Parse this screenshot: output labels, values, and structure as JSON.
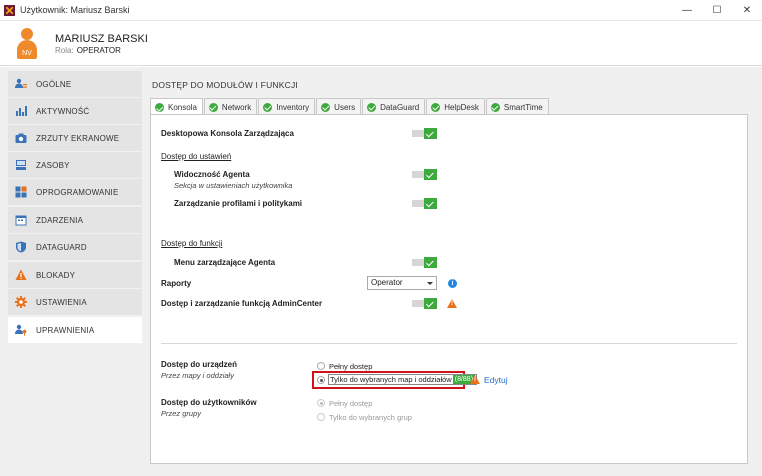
{
  "window": {
    "title": "Użytkownik: Mariusz Barski",
    "controls": {
      "minimize": "—",
      "maximize": "☐",
      "close": "✕"
    }
  },
  "user": {
    "name": "MARIUSZ BARSKI",
    "role_label": "Rola:",
    "role_value": "OPERATOR",
    "avatar_initials": "NV"
  },
  "sidebar": {
    "items": [
      {
        "label": "OGÓLNE",
        "icon": "user-settings-icon"
      },
      {
        "label": "AKTYWNOŚĆ",
        "icon": "activity-chart-icon"
      },
      {
        "label": "ZRZUTY EKRANOWE",
        "icon": "camera-icon"
      },
      {
        "label": "ZASOBY",
        "icon": "hardware-icon"
      },
      {
        "label": "OPROGRAMOWANIE",
        "icon": "software-blocks-icon"
      },
      {
        "label": "ZDARZENIA",
        "icon": "calendar-icon"
      },
      {
        "label": "DATAGUARD",
        "icon": "shield-icon"
      },
      {
        "label": "BLOKADY",
        "icon": "warning-icon"
      },
      {
        "label": "USTAWIENIA",
        "icon": "gear-icon"
      },
      {
        "label": "UPRAWNIENIA",
        "icon": "user-key-icon"
      }
    ],
    "active_index": 9
  },
  "main": {
    "section_title": "DOSTĘP DO MODUŁÓW I FUNKCJI",
    "tabs": [
      {
        "label": "Konsola"
      },
      {
        "label": "Network"
      },
      {
        "label": "Inventory"
      },
      {
        "label": "Users"
      },
      {
        "label": "DataGuard"
      },
      {
        "label": "HelpDesk"
      },
      {
        "label": "SmartTime"
      }
    ],
    "active_tab": "Konsola",
    "console": {
      "desktop_console": "Desktopowa Konsola Zarządzająca",
      "settings_access": "Dostęp do ustawień",
      "agent_visibility": "Widoczność Agenta",
      "agent_visibility_sub": "Sekcja w ustawieniach użytkownika",
      "profiles_policies": "Zarządzanie profilami i politykami",
      "functions_access": "Dostęp do funkcji",
      "agent_menu": "Menu zarządzające Agenta",
      "reports": "Raporty",
      "reports_value": "Operator",
      "admincenter": "Dostęp i zarządzanie funkcją AdminCenter",
      "toggles": {
        "desktop_console": true,
        "agent_visibility": true,
        "profiles_policies": true,
        "agent_menu": true,
        "admincenter": true
      }
    },
    "devices": {
      "title": "Dostęp do urządzeń",
      "subtitle": "Przez mapy i oddziały",
      "option_full": "Pełny dostęp",
      "option_selected": "Tylko do wybranych map i oddziałów",
      "selected_count": "(8/88)",
      "edit_label": "Edytuj"
    },
    "users": {
      "title": "Dostęp do użytkowników",
      "subtitle": "Przez grupy",
      "option_full": "Pełny dostęp",
      "option_selected": "Tylko do wybranych grup"
    }
  },
  "colors": {
    "accent_green": "#3caa3c",
    "warning_orange": "#e8711b",
    "info_blue": "#1e88e5",
    "highlight_red": "#d0121a",
    "avatar_orange": "#ef8a2a"
  }
}
